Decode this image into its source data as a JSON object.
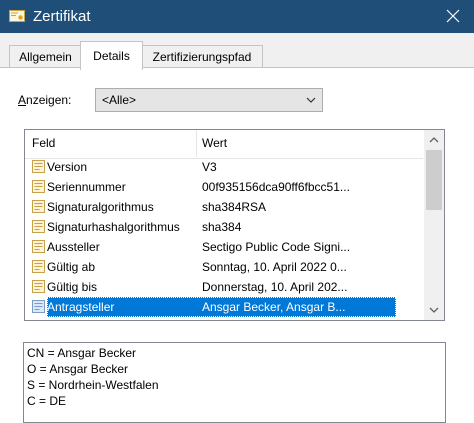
{
  "window": {
    "title": "Zertifikat",
    "accent": "#1f4e79"
  },
  "tabs": [
    {
      "label": "Allgemein",
      "active": false
    },
    {
      "label": "Details",
      "active": true
    },
    {
      "label": "Zertifizierungspfad",
      "active": false
    }
  ],
  "show": {
    "label_prefix": "A",
    "label_rest": "nzeigen:",
    "value": "<Alle>"
  },
  "list": {
    "columns": [
      "Feld",
      "Wert"
    ],
    "rows": [
      {
        "field": "Version",
        "value": "V3"
      },
      {
        "field": "Seriennummer",
        "value": "00f935156dca90ff6fbcc51..."
      },
      {
        "field": "Signaturalgorithmus",
        "value": "sha384RSA"
      },
      {
        "field": "Signaturhashalgorithmus",
        "value": "sha384"
      },
      {
        "field": "Aussteller",
        "value": "Sectigo Public Code Signi..."
      },
      {
        "field": "Gültig ab",
        "value": "Sonntag, 10. April 2022 0..."
      },
      {
        "field": "Gültig bis",
        "value": "Donnerstag, 10. April 202..."
      },
      {
        "field": "Antragsteller",
        "value": "Ansgar Becker, Ansgar B...",
        "selected": true
      }
    ]
  },
  "details": {
    "lines": [
      "CN = Ansgar Becker",
      "O = Ansgar Becker",
      "S = Nordrhein-Westfalen",
      "C = DE"
    ]
  }
}
